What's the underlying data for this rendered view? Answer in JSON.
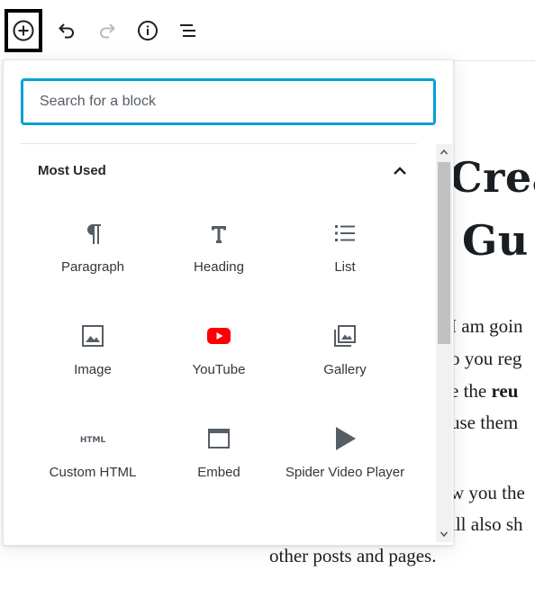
{
  "toolbar": {
    "inserter_icon": "plus-circle-icon",
    "undo_icon": "undo-icon",
    "redo_icon": "redo-icon",
    "info_icon": "info-icon",
    "outline_icon": "list-outline-icon"
  },
  "post": {
    "title_line_1": "Crea",
    "title_line_2": "Gu",
    "body_line_1": "I am goin",
    "body_line_2": "o you reg",
    "body_line_3_prefix": "e the ",
    "body_line_3_bold": "reu",
    "body_line_4": "use them",
    "body_line_5": "w you the",
    "body_line_6": "ill also sh",
    "body_line_7": "other posts and pages."
  },
  "inserter": {
    "search_placeholder": "Search for a block",
    "panel_title": "Most Used",
    "blocks": [
      {
        "label": "Paragraph",
        "icon": "paragraph-icon"
      },
      {
        "label": "Heading",
        "icon": "heading-icon"
      },
      {
        "label": "List",
        "icon": "list-icon"
      },
      {
        "label": "Image",
        "icon": "image-icon"
      },
      {
        "label": "YouTube",
        "icon": "youtube-icon"
      },
      {
        "label": "Gallery",
        "icon": "gallery-icon"
      },
      {
        "label": "Custom HTML",
        "icon": "html-icon"
      },
      {
        "label": "Embed",
        "icon": "embed-icon"
      },
      {
        "label": "Spider Video Player",
        "icon": "play-icon"
      }
    ]
  },
  "colors": {
    "focus_border": "#00a0d2",
    "icon_gray": "#555d66",
    "youtube_red": "#ff0000"
  }
}
